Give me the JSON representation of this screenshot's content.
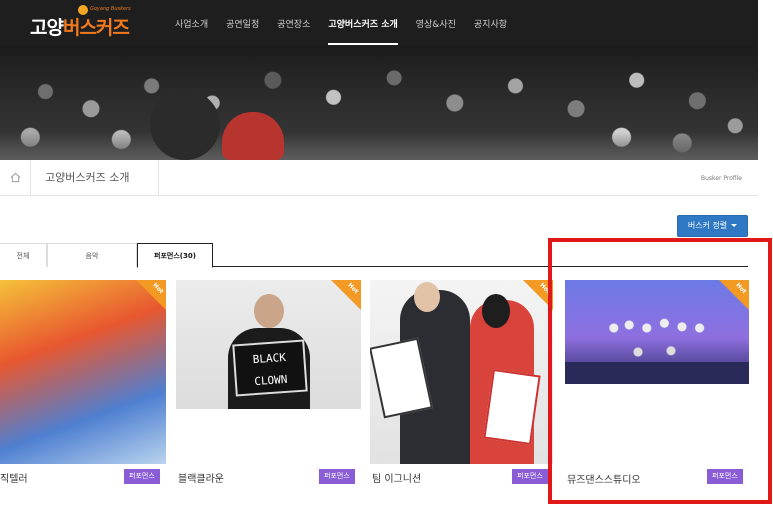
{
  "header": {
    "logo_text_a": "고양",
    "logo_text_b": "버스커즈",
    "logo_sub": "Goyang Buskers",
    "nav": [
      {
        "label": "사업소개",
        "active": false
      },
      {
        "label": "공연일정",
        "active": false
      },
      {
        "label": "공연장소",
        "active": false
      },
      {
        "label": "고양버스커즈 소개",
        "active": true
      },
      {
        "label": "영상&사진",
        "active": false
      },
      {
        "label": "공지사항",
        "active": false
      }
    ]
  },
  "breadcrumb": {
    "home_icon": "home-icon",
    "title": "고양버스커즈 소개",
    "right_label": "Busker Profile"
  },
  "sort_button": {
    "label": "버스커 정렬"
  },
  "tabs": [
    {
      "label": "전체",
      "active": false
    },
    {
      "label": "음악",
      "active": false
    },
    {
      "label": "퍼포먼스(30)",
      "active": true
    }
  ],
  "hot_label": "Hot",
  "cards": [
    {
      "name": "직텔러",
      "badge": "퍼포먼스",
      "hot": true
    },
    {
      "name": "블랙클라운",
      "badge": "퍼포먼스",
      "hot": true,
      "sign_line1": "BLACK",
      "sign_line2": "CLOWN"
    },
    {
      "name": "팀 이그니션",
      "badge": "퍼포먼스",
      "hot": true
    },
    {
      "name": "뮤즈댄스스튜디오",
      "badge": "퍼포먼스",
      "hot": true
    }
  ],
  "colors": {
    "nav_bg": "#1e1e1e",
    "accent_orange": "#f07a1c",
    "hot_ribbon": "#f29a23",
    "badge_purple": "#8a5cd6",
    "sort_button_blue": "#2f79c4",
    "highlight_red": "#e01818"
  }
}
